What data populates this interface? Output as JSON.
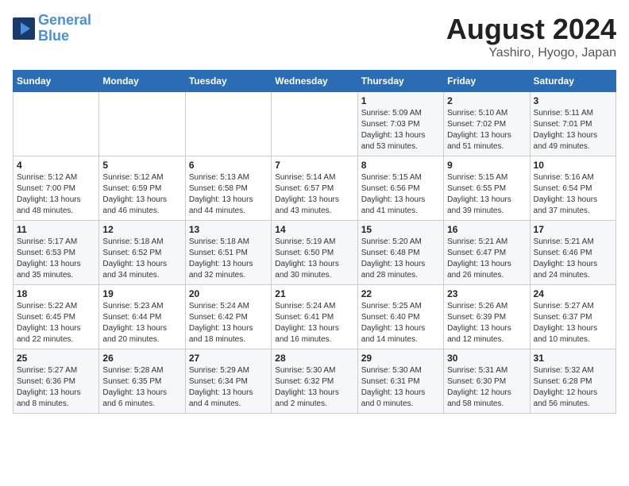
{
  "header": {
    "logo_line1": "General",
    "logo_line2": "Blue",
    "month_title": "August 2024",
    "location": "Yashiro, Hyogo, Japan"
  },
  "weekdays": [
    "Sunday",
    "Monday",
    "Tuesday",
    "Wednesday",
    "Thursday",
    "Friday",
    "Saturday"
  ],
  "weeks": [
    [
      {
        "day": "",
        "info": ""
      },
      {
        "day": "",
        "info": ""
      },
      {
        "day": "",
        "info": ""
      },
      {
        "day": "",
        "info": ""
      },
      {
        "day": "1",
        "info": "Sunrise: 5:09 AM\nSunset: 7:03 PM\nDaylight: 13 hours\nand 53 minutes."
      },
      {
        "day": "2",
        "info": "Sunrise: 5:10 AM\nSunset: 7:02 PM\nDaylight: 13 hours\nand 51 minutes."
      },
      {
        "day": "3",
        "info": "Sunrise: 5:11 AM\nSunset: 7:01 PM\nDaylight: 13 hours\nand 49 minutes."
      }
    ],
    [
      {
        "day": "4",
        "info": "Sunrise: 5:12 AM\nSunset: 7:00 PM\nDaylight: 13 hours\nand 48 minutes."
      },
      {
        "day": "5",
        "info": "Sunrise: 5:12 AM\nSunset: 6:59 PM\nDaylight: 13 hours\nand 46 minutes."
      },
      {
        "day": "6",
        "info": "Sunrise: 5:13 AM\nSunset: 6:58 PM\nDaylight: 13 hours\nand 44 minutes."
      },
      {
        "day": "7",
        "info": "Sunrise: 5:14 AM\nSunset: 6:57 PM\nDaylight: 13 hours\nand 43 minutes."
      },
      {
        "day": "8",
        "info": "Sunrise: 5:15 AM\nSunset: 6:56 PM\nDaylight: 13 hours\nand 41 minutes."
      },
      {
        "day": "9",
        "info": "Sunrise: 5:15 AM\nSunset: 6:55 PM\nDaylight: 13 hours\nand 39 minutes."
      },
      {
        "day": "10",
        "info": "Sunrise: 5:16 AM\nSunset: 6:54 PM\nDaylight: 13 hours\nand 37 minutes."
      }
    ],
    [
      {
        "day": "11",
        "info": "Sunrise: 5:17 AM\nSunset: 6:53 PM\nDaylight: 13 hours\nand 35 minutes."
      },
      {
        "day": "12",
        "info": "Sunrise: 5:18 AM\nSunset: 6:52 PM\nDaylight: 13 hours\nand 34 minutes."
      },
      {
        "day": "13",
        "info": "Sunrise: 5:18 AM\nSunset: 6:51 PM\nDaylight: 13 hours\nand 32 minutes."
      },
      {
        "day": "14",
        "info": "Sunrise: 5:19 AM\nSunset: 6:50 PM\nDaylight: 13 hours\nand 30 minutes."
      },
      {
        "day": "15",
        "info": "Sunrise: 5:20 AM\nSunset: 6:48 PM\nDaylight: 13 hours\nand 28 minutes."
      },
      {
        "day": "16",
        "info": "Sunrise: 5:21 AM\nSunset: 6:47 PM\nDaylight: 13 hours\nand 26 minutes."
      },
      {
        "day": "17",
        "info": "Sunrise: 5:21 AM\nSunset: 6:46 PM\nDaylight: 13 hours\nand 24 minutes."
      }
    ],
    [
      {
        "day": "18",
        "info": "Sunrise: 5:22 AM\nSunset: 6:45 PM\nDaylight: 13 hours\nand 22 minutes."
      },
      {
        "day": "19",
        "info": "Sunrise: 5:23 AM\nSunset: 6:44 PM\nDaylight: 13 hours\nand 20 minutes."
      },
      {
        "day": "20",
        "info": "Sunrise: 5:24 AM\nSunset: 6:42 PM\nDaylight: 13 hours\nand 18 minutes."
      },
      {
        "day": "21",
        "info": "Sunrise: 5:24 AM\nSunset: 6:41 PM\nDaylight: 13 hours\nand 16 minutes."
      },
      {
        "day": "22",
        "info": "Sunrise: 5:25 AM\nSunset: 6:40 PM\nDaylight: 13 hours\nand 14 minutes."
      },
      {
        "day": "23",
        "info": "Sunrise: 5:26 AM\nSunset: 6:39 PM\nDaylight: 13 hours\nand 12 minutes."
      },
      {
        "day": "24",
        "info": "Sunrise: 5:27 AM\nSunset: 6:37 PM\nDaylight: 13 hours\nand 10 minutes."
      }
    ],
    [
      {
        "day": "25",
        "info": "Sunrise: 5:27 AM\nSunset: 6:36 PM\nDaylight: 13 hours\nand 8 minutes."
      },
      {
        "day": "26",
        "info": "Sunrise: 5:28 AM\nSunset: 6:35 PM\nDaylight: 13 hours\nand 6 minutes."
      },
      {
        "day": "27",
        "info": "Sunrise: 5:29 AM\nSunset: 6:34 PM\nDaylight: 13 hours\nand 4 minutes."
      },
      {
        "day": "28",
        "info": "Sunrise: 5:30 AM\nSunset: 6:32 PM\nDaylight: 13 hours\nand 2 minutes."
      },
      {
        "day": "29",
        "info": "Sunrise: 5:30 AM\nSunset: 6:31 PM\nDaylight: 13 hours\nand 0 minutes."
      },
      {
        "day": "30",
        "info": "Sunrise: 5:31 AM\nSunset: 6:30 PM\nDaylight: 12 hours\nand 58 minutes."
      },
      {
        "day": "31",
        "info": "Sunrise: 5:32 AM\nSunset: 6:28 PM\nDaylight: 12 hours\nand 56 minutes."
      }
    ]
  ]
}
